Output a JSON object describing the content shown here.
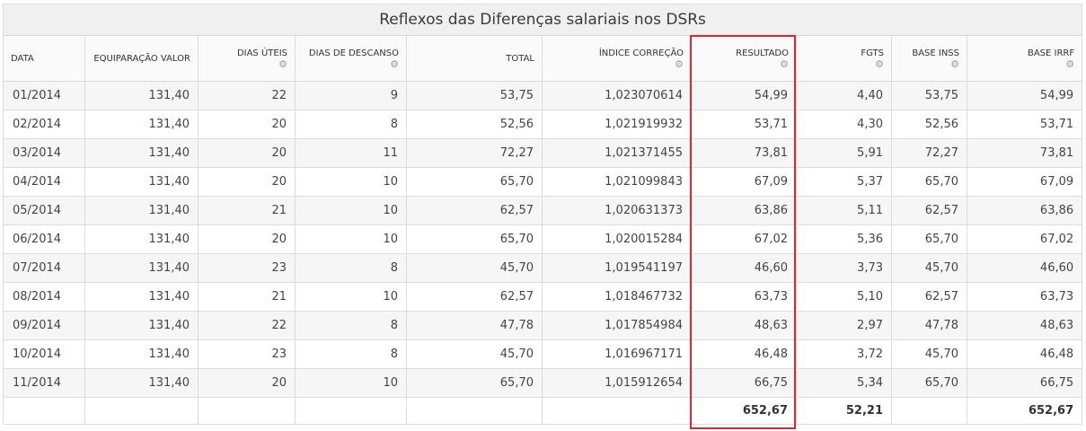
{
  "title": "Reflexos das Diferenças salariais nos DSRs",
  "columns": [
    {
      "label": "DATA",
      "gear": false
    },
    {
      "label": "EQUIPARAÇÃO VALOR",
      "gear": false
    },
    {
      "label": "DIAS ÚTEIS",
      "gear": true
    },
    {
      "label": "DIAS DE DESCANSO",
      "gear": true
    },
    {
      "label": "TOTAL",
      "gear": false
    },
    {
      "label": "ÍNDICE CORREÇÃO",
      "gear": true
    },
    {
      "label": "RESULTADO",
      "gear": true
    },
    {
      "label": "FGTS",
      "gear": true
    },
    {
      "label": "BASE INSS",
      "gear": true
    },
    {
      "label": "BASE IRRF",
      "gear": true
    }
  ],
  "rows": [
    [
      "01/2014",
      "131,40",
      "22",
      "9",
      "53,75",
      "1,023070614",
      "54,99",
      "4,40",
      "53,75",
      "54,99"
    ],
    [
      "02/2014",
      "131,40",
      "20",
      "8",
      "52,56",
      "1,021919932",
      "53,71",
      "4,30",
      "52,56",
      "53,71"
    ],
    [
      "03/2014",
      "131,40",
      "20",
      "11",
      "72,27",
      "1,021371455",
      "73,81",
      "5,91",
      "72,27",
      "73,81"
    ],
    [
      "04/2014",
      "131,40",
      "20",
      "10",
      "65,70",
      "1,021099843",
      "67,09",
      "5,37",
      "65,70",
      "67,09"
    ],
    [
      "05/2014",
      "131,40",
      "21",
      "10",
      "62,57",
      "1,020631373",
      "63,86",
      "5,11",
      "62,57",
      "63,86"
    ],
    [
      "06/2014",
      "131,40",
      "20",
      "10",
      "65,70",
      "1,020015284",
      "67,02",
      "5,36",
      "65,70",
      "67,02"
    ],
    [
      "07/2014",
      "131,40",
      "23",
      "8",
      "45,70",
      "1,019541197",
      "46,60",
      "3,73",
      "45,70",
      "46,60"
    ],
    [
      "08/2014",
      "131,40",
      "21",
      "10",
      "62,57",
      "1,018467732",
      "63,73",
      "5,10",
      "62,57",
      "63,73"
    ],
    [
      "09/2014",
      "131,40",
      "22",
      "8",
      "47,78",
      "1,017854984",
      "48,63",
      "2,97",
      "47,78",
      "48,63"
    ],
    [
      "10/2014",
      "131,40",
      "23",
      "8",
      "45,70",
      "1,016967171",
      "46,48",
      "3,72",
      "45,70",
      "46,48"
    ],
    [
      "11/2014",
      "131,40",
      "20",
      "10",
      "65,70",
      "1,015912654",
      "66,75",
      "5,34",
      "65,70",
      "66,75"
    ]
  ],
  "totals": [
    "",
    "",
    "",
    "",
    "",
    "",
    "652,67",
    "52,21",
    "",
    "652,67"
  ],
  "colors": {
    "highlight": "#e3242b",
    "stripe": "#f6f6f6",
    "header_bg": "#f0f0f0"
  },
  "icons": {
    "gear": "gear-icon"
  }
}
